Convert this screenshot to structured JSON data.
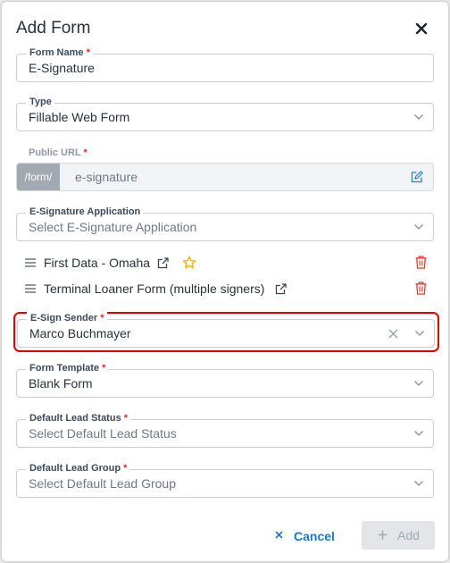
{
  "dialog": {
    "title": "Add Form"
  },
  "form_name": {
    "label": "Form Name",
    "required": "*",
    "value": "E-Signature"
  },
  "type": {
    "label": "Type",
    "value": "Fillable Web Form"
  },
  "public_url": {
    "label": "Public URL",
    "required": "*",
    "prefix": "/form/",
    "placeholder": "e-signature"
  },
  "esig_app": {
    "label": "E-Signature Application",
    "placeholder": "Select E-Signature Application",
    "items": [
      {
        "name": "First Data - Omaha",
        "starred": true
      },
      {
        "name": "Terminal Loaner Form (multiple signers)",
        "starred": false
      }
    ]
  },
  "esign_sender": {
    "label": "E-Sign Sender",
    "required": "*",
    "value": "Marco Buchmayer"
  },
  "form_template": {
    "label": "Form Template",
    "required": "*",
    "value": "Blank Form"
  },
  "lead_status": {
    "label": "Default Lead Status",
    "required": "*",
    "placeholder": "Select Default Lead Status"
  },
  "lead_group": {
    "label": "Default Lead Group",
    "required": "*",
    "placeholder": "Select Default Lead Group"
  },
  "actions": {
    "cancel": "Cancel",
    "add": "Add"
  },
  "colors": {
    "accent": "#1976c8",
    "danger": "#e53935",
    "star": "#f2b705",
    "highlight": "#e00000"
  },
  "icons": [
    "close-icon",
    "chevron-down-icon",
    "edit-icon",
    "drag-handle-icon",
    "external-link-icon",
    "star-icon",
    "trash-icon",
    "clear-icon",
    "plus-icon"
  ]
}
